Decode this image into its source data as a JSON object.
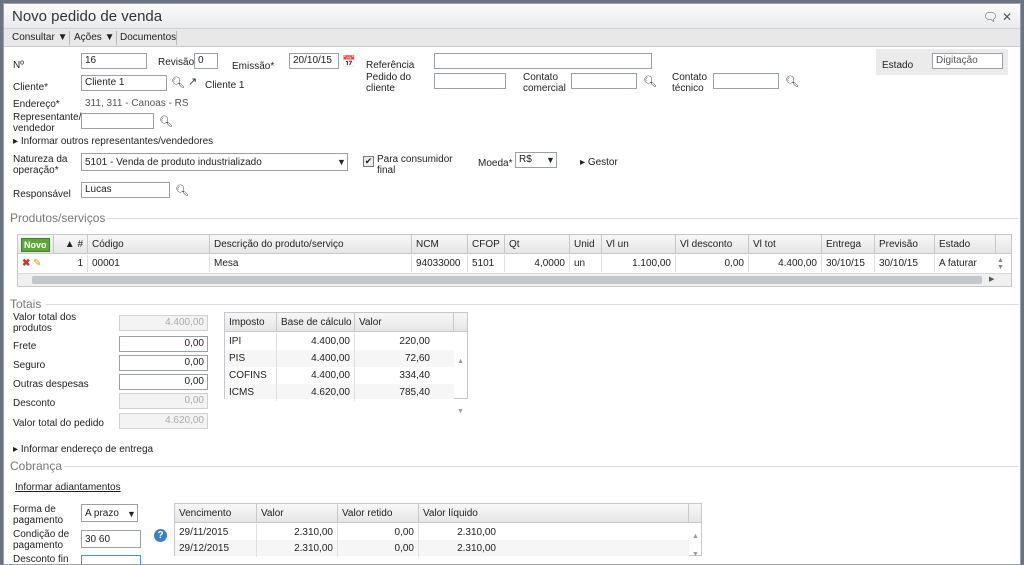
{
  "window": {
    "title": "Novo pedido de venda",
    "icons": [
      "speech-bubble-icon",
      "close-icon"
    ]
  },
  "menu": {
    "consultar": "Consultar",
    "acoes": "Ações",
    "documentos": "Documentos"
  },
  "header": {
    "numero_label": "Nº",
    "numero": "16",
    "revisao_label": "Revisão",
    "revisao": "0",
    "emissao_label": "Emissão*",
    "emissao": "20/10/15",
    "referencia_label": "Referência",
    "referencia": "",
    "estado_label": "Estado",
    "estado": "Digitação",
    "cliente_label": "Cliente*",
    "cliente": "Cliente 1",
    "cliente_link": "Cliente 1",
    "pedido_cliente_label_1": "Pedido do",
    "pedido_cliente_label_2": "cliente",
    "pedido_cliente": "",
    "contato_comercial_label_1": "Contato",
    "contato_comercial_label_2": "comercial",
    "contato_comercial": "",
    "contato_tecnico_label_1": "Contato",
    "contato_tecnico_label_2": "técnico",
    "contato_tecnico": "",
    "endereco_label": "Endereço*",
    "endereco": "311, 311 - Canoas - RS",
    "representante_label_1": "Representante/",
    "representante_label_2": "vendedor",
    "representante": "",
    "outros_representantes": "Informar outros representantes/vendedores",
    "natureza_label_1": "Natureza da",
    "natureza_label_2": "operação*",
    "natureza": "5101 - Venda de produto industrializado",
    "consumidor_label_1": "Para consumidor",
    "consumidor_label_2": "final",
    "consumidor_checked": true,
    "moeda_label": "Moeda*",
    "moeda": "R$",
    "gestor": "Gestor",
    "responsavel_label": "Responsável",
    "responsavel": "Lucas"
  },
  "produtos": {
    "section": "Produtos/serviços",
    "novo": "Novo",
    "columns": [
      "#",
      "Código",
      "Descrição do produto/serviço",
      "NCM",
      "CFOP",
      "Qt",
      "Unid",
      "Vl un",
      "Vl desconto",
      "Vl tot",
      "Entrega",
      "Previsão",
      "Estado"
    ],
    "rows": [
      {
        "n": "1",
        "codigo": "00001",
        "descricao": "Mesa",
        "ncm": "94033000",
        "cfop": "5101",
        "qt": "4,0000",
        "unid": "un",
        "vl_un": "1.100,00",
        "vl_desconto": "0,00",
        "vl_tot": "4.400,00",
        "entrega": "30/10/15",
        "previsao": "30/10/15",
        "estado": "A faturar"
      }
    ]
  },
  "totais": {
    "section": "Totais",
    "valor_produtos_label_1": "Valor total dos",
    "valor_produtos_label_2": "produtos",
    "valor_produtos": "4.400,00",
    "frete_label": "Frete",
    "frete": "0,00",
    "seguro_label": "Seguro",
    "seguro": "0,00",
    "outras_label": "Outras despesas",
    "outras": "0,00",
    "desconto_label": "Desconto",
    "desconto": "0,00",
    "valor_pedido_label": "Valor total do pedido",
    "valor_pedido": "4.620,00",
    "impostos_columns": [
      "Imposto",
      "Base de cálculo",
      "Valor"
    ],
    "impostos": [
      {
        "imposto": "IPI",
        "base": "4.400,00",
        "valor": "220,00"
      },
      {
        "imposto": "PIS",
        "base": "4.400,00",
        "valor": "72,60"
      },
      {
        "imposto": "COFINS",
        "base": "4.400,00",
        "valor": "334,40"
      },
      {
        "imposto": "ICMS",
        "base": "4.620,00",
        "valor": "785,40"
      }
    ],
    "endereco_entrega": "Informar endereço de entrega"
  },
  "cobranca": {
    "section": "Cobrança",
    "adiantamentos": "Informar adiantamentos",
    "forma_label_1": "Forma de",
    "forma_label_2": "pagamento",
    "forma": "A prazo",
    "condicao_label_1": "Condição de",
    "condicao_label_2": "pagamento",
    "condicao": "30 60",
    "desconto_fin_label_1": "Desconto fin",
    "desconto_fin_label_2": "(%)",
    "parcelas_columns": [
      "Vencimento",
      "Valor",
      "Valor retido",
      "Valor líquido"
    ],
    "parcelas": [
      {
        "vencimento": "29/11/2015",
        "valor": "2.310,00",
        "retido": "0,00",
        "liquido": "2.310,00"
      },
      {
        "vencimento": "29/12/2015",
        "valor": "2.310,00",
        "retido": "0,00",
        "liquido": "2.310,00"
      }
    ]
  }
}
